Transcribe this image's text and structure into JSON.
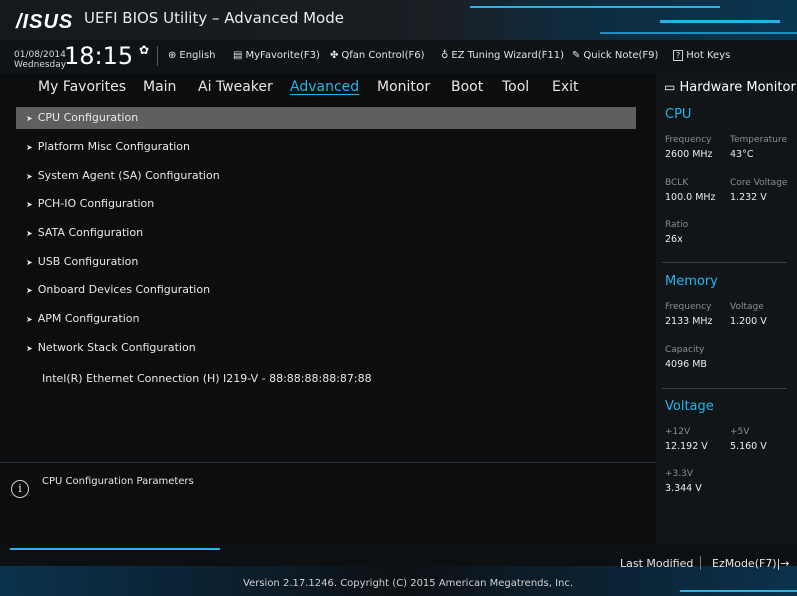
{
  "header": {
    "logo": "/ISUS",
    "title": "UEFI BIOS Utility – Advanced Mode"
  },
  "infobar": {
    "date": "01/08/2014",
    "weekday": "Wednesday",
    "time": "18:15",
    "items": [
      {
        "label": "English",
        "icon": "globe-icon"
      },
      {
        "label": "MyFavorite(F3)",
        "icon": "favorite-icon"
      },
      {
        "label": "Qfan Control(F6)",
        "icon": "fan-icon"
      },
      {
        "label": "EZ Tuning Wizard(F11)",
        "icon": "bulb-icon"
      },
      {
        "label": "Quick Note(F9)",
        "icon": "note-icon"
      },
      {
        "label": "Hot Keys",
        "icon": "question-icon"
      }
    ]
  },
  "nav": {
    "tabs": [
      "My Favorites",
      "Main",
      "Ai Tweaker",
      "Advanced",
      "Monitor",
      "Boot",
      "Tool",
      "Exit"
    ],
    "active": "Advanced"
  },
  "menu": {
    "items": [
      "CPU Configuration",
      "Platform Misc Configuration",
      "System Agent (SA) Configuration",
      "PCH-IO Configuration",
      "SATA Configuration",
      "USB Configuration",
      "Onboard Devices Configuration",
      "APM Configuration",
      "Network Stack Configuration"
    ],
    "static_line": "Intel(R) Ethernet Connection (H) I219-V - 88:88:88:88:87:88"
  },
  "help": {
    "text": "CPU Configuration Parameters"
  },
  "hardware_monitor": {
    "title": "Hardware Monitor",
    "cpu": {
      "heading": "CPU",
      "frequency_label": "Frequency",
      "frequency": "2600 MHz",
      "temperature_label": "Temperature",
      "temperature": "43°C",
      "bclk_label": "BCLK",
      "bclk": "100.0 MHz",
      "core_voltage_label": "Core Voltage",
      "core_voltage": "1.232 V",
      "ratio_label": "Ratio",
      "ratio": "26x"
    },
    "memory": {
      "heading": "Memory",
      "frequency_label": "Frequency",
      "frequency": "2133 MHz",
      "voltage_label": "Voltage",
      "voltage": "1.200 V",
      "capacity_label": "Capacity",
      "capacity": "4096 MB"
    },
    "voltage": {
      "heading": "Voltage",
      "v12_label": "+12V",
      "v12": "12.192 V",
      "v5_label": "+5V",
      "v5": "5.160 V",
      "v33_label": "+3.3V",
      "v33": "3.344 V"
    }
  },
  "footer": {
    "copyright": "Version 2.17.1246. Copyright (C) 2015 American Megatrends, Inc.",
    "last_modified": "Last Modified",
    "ezmode": "EzMode(F7)|→"
  },
  "colors": {
    "accent": "#25b4e8",
    "selection": "#5d5f61",
    "background": "#0b0d0f"
  }
}
